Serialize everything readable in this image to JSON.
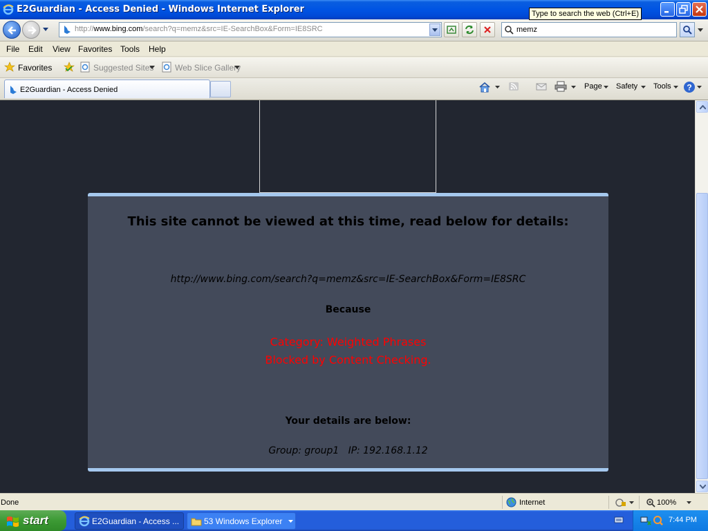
{
  "window": {
    "title": "E2Guardian - Access Denied - Windows Internet Explorer",
    "tooltip": "Type to search the web (Ctrl+E)"
  },
  "address": {
    "url_prefix": "http://",
    "url_host": "www.bing.com",
    "url_path": "/search?q=memz&src=IE-SearchBox&Form=IE8SRC"
  },
  "search": {
    "value": "memz"
  },
  "menu": {
    "items": [
      "File",
      "Edit",
      "View",
      "Favorites",
      "Tools",
      "Help"
    ]
  },
  "favorites_bar": {
    "favorites_label": "Favorites",
    "suggested_sites": "Suggested Sites",
    "web_slice_gallery": "Web Slice Gallery"
  },
  "tab": {
    "title": "E2Guardian - Access Denied"
  },
  "command_bar": {
    "page": "Page",
    "safety": "Safety",
    "tools": "Tools"
  },
  "page": {
    "heading": "This site cannot be viewed at this time, read below for details:",
    "blocked_url": "http://www.bing.com/search?q=memz&src=IE-SearchBox&Form=IE8SRC",
    "because": "Because",
    "reason_line1": "Category: Weighted Phrases",
    "reason_line2": "Blocked by Content Checking.",
    "details_heading": "Your details are below:",
    "group_ip": "Group: group1   IP: 192.168.1.12",
    "accent_red": "#ff0000",
    "panel_border": "#a5c8ee"
  },
  "status_bar": {
    "status": "Done",
    "zone": "Internet",
    "zoom": "100%"
  },
  "taskbar": {
    "start": "start",
    "items": [
      "E2Guardian - Access ...",
      "53 Windows Explorer"
    ],
    "clock": "7:44 PM"
  }
}
